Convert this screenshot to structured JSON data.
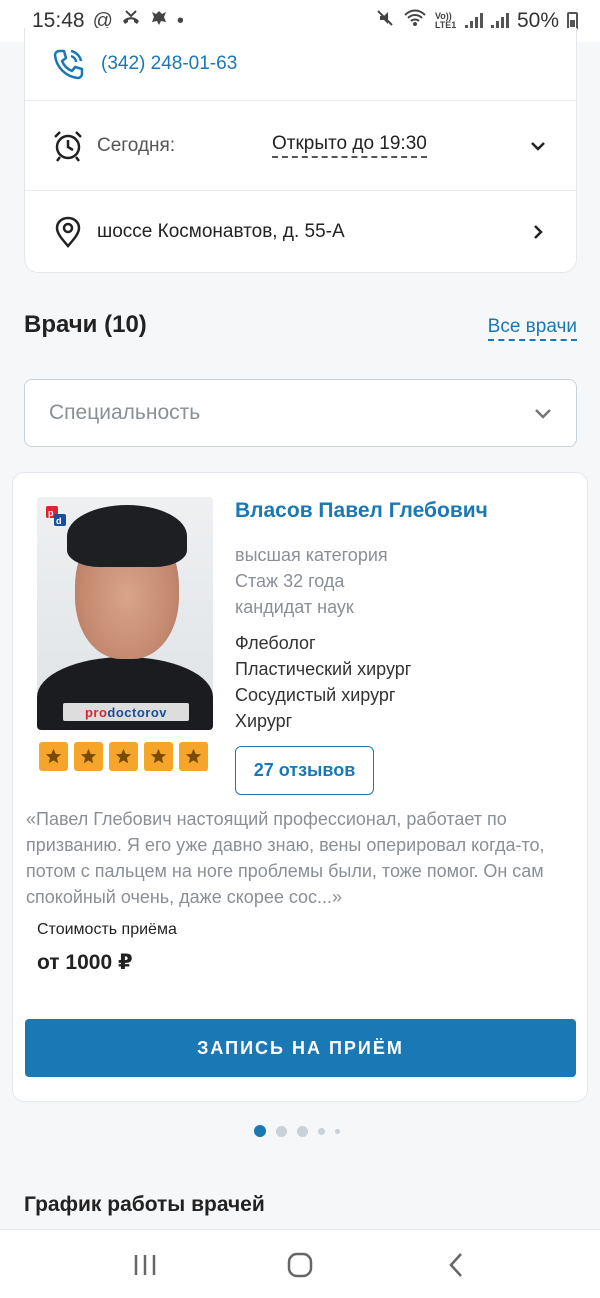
{
  "status_bar": {
    "time": "15:48",
    "icons_left": [
      "at-sign-icon",
      "missed-call-icon",
      "emblem-icon",
      "dot-icon"
    ],
    "icons_right": [
      "mute-icon",
      "wifi-icon",
      "volte-icon",
      "signal-icon",
      "signal-icon"
    ],
    "volte_text": "Vo)) LTE1",
    "battery": "50%"
  },
  "clinic": {
    "phone": "(342) 248-01-63",
    "today_label": "Сегодня:",
    "today_value": "Открыто до 19:30",
    "address": "шоссе Космонавтов, д. 55-А"
  },
  "doctors": {
    "title": "Врачи (10)",
    "all_link": "Все врачи",
    "specialty_placeholder": "Специальность"
  },
  "doctor_card": {
    "name": "Власов Павел Глебович",
    "meta": [
      "высшая категория",
      "Стаж 32 года",
      "кандидат наук"
    ],
    "specialties": [
      "Флеболог",
      "Пластический хирург",
      "Сосудистый хирург",
      "Хирург"
    ],
    "rating_stars": 5,
    "reviews_label": "27 отзывов",
    "photo_watermark_red": "pro",
    "photo_watermark_blue": "doctorov",
    "quote": "«Павел Глебович настоящий профессионал, работает по призванию. Я его уже давно знаю, вены оперировал когда-то, потом с пальцем на ноге проблемы были, тоже помог. Он сам спокойный очень, даже скорее сос...»",
    "price_label": "Стоимость приёма",
    "price_value": "от 1000 ₽",
    "book_button": "ЗАПИСЬ НА ПРИЁМ"
  },
  "pagination": {
    "total": 5,
    "active": 1
  },
  "schedule_title": "График работы врачей",
  "colors": {
    "accent": "#1a78b5",
    "star": "#f4a52a"
  }
}
